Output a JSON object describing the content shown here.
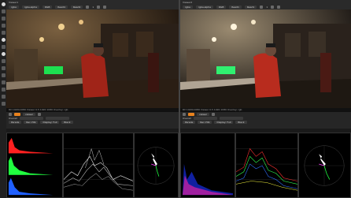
{
  "left": {
    "pane_title": "Viewer1",
    "tabs": [
      "rgba",
      "rgba.alpha",
      "RGB",
      "Read4",
      "Read4"
    ],
    "zoom": "1",
    "mode": "viewer",
    "info": "RV 1920x1080 Viewer 0.5 1920 1080 Overlay: rgb",
    "ctrl_label": "Overall",
    "scope_menu": "Parade",
    "scope_sel": [
      "Rec.709",
      "Display: Full",
      "Black",
      "Overlay"
    ]
  },
  "right": {
    "pane_title": "Viewer2",
    "tabs": [
      "rgba",
      "rgba.alpha",
      "RGB",
      "Read1",
      "Read1"
    ],
    "zoom": "1",
    "mode": "viewer",
    "info": "RV 1920x1080 Viewer 0.5 1920 1080 Overlay: rgb",
    "ctrl_label": "Overall",
    "scope_menu": "Parade",
    "scope_sel": [
      "Rec.709",
      "Display: Full",
      "Black",
      "Overlay"
    ]
  },
  "colors": {
    "accent": "#e8821e",
    "bg": "#1a1a1a",
    "scope_red": "#ff2020",
    "scope_green": "#20ff40",
    "scope_blue": "#2060ff"
  },
  "icons": [
    "menu-icon",
    "settings-icon",
    "zoom-icon",
    "lock-icon",
    "color-picker-icon"
  ]
}
